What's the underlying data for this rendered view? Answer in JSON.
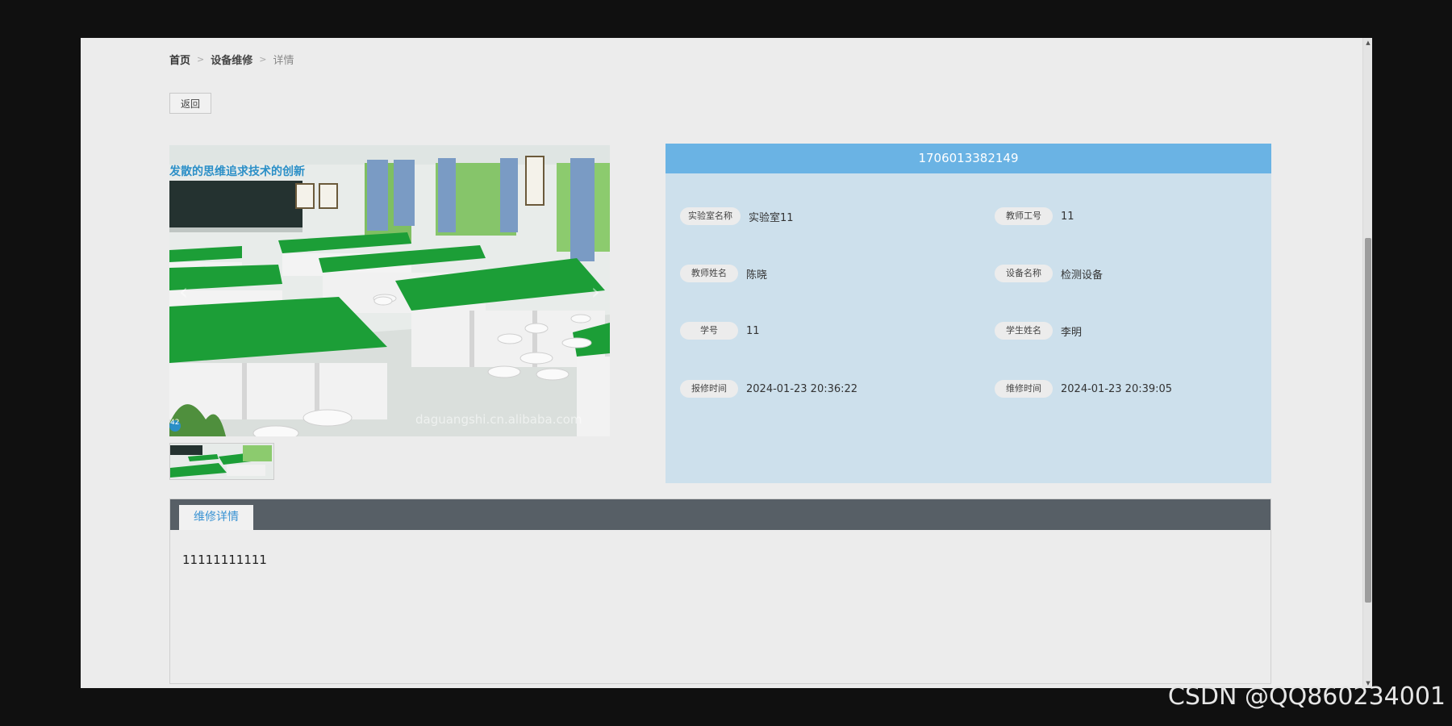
{
  "breadcrumb": {
    "home": "首页",
    "section": "设备维修",
    "current": "详情",
    "separator": ">"
  },
  "buttons": {
    "back": "返回"
  },
  "gallery": {
    "banner_text": "发散的思维追求技术的创新",
    "watermark": "daguangshi.cn.alibaba.com",
    "corner_badge": "42",
    "prev_arrow": "‹",
    "next_arrow": "›",
    "colors": {
      "bench_green": "#1c9e37",
      "wall": "#e8ecea",
      "floor": "#dadfdc"
    }
  },
  "info": {
    "id": "1706013382149",
    "fields": [
      {
        "label": "实验室名称",
        "value": "实验室11"
      },
      {
        "label": "教师工号",
        "value": "11"
      },
      {
        "label": "教师姓名",
        "value": "陈晓"
      },
      {
        "label": "设备名称",
        "value": "检测设备"
      },
      {
        "label": "学号",
        "value": "11"
      },
      {
        "label": "学生姓名",
        "value": "李明"
      },
      {
        "label": "报修时间",
        "value": "2024-01-23 20:36:22"
      },
      {
        "label": "维修时间",
        "value": "2024-01-23 20:39:05"
      }
    ],
    "colors": {
      "header": "#6ab3e4",
      "panel": "#cde0ec"
    }
  },
  "detail": {
    "tab_label": "维修详情",
    "content": "11111111111"
  },
  "footer_watermark": "CSDN @QQ860234001"
}
